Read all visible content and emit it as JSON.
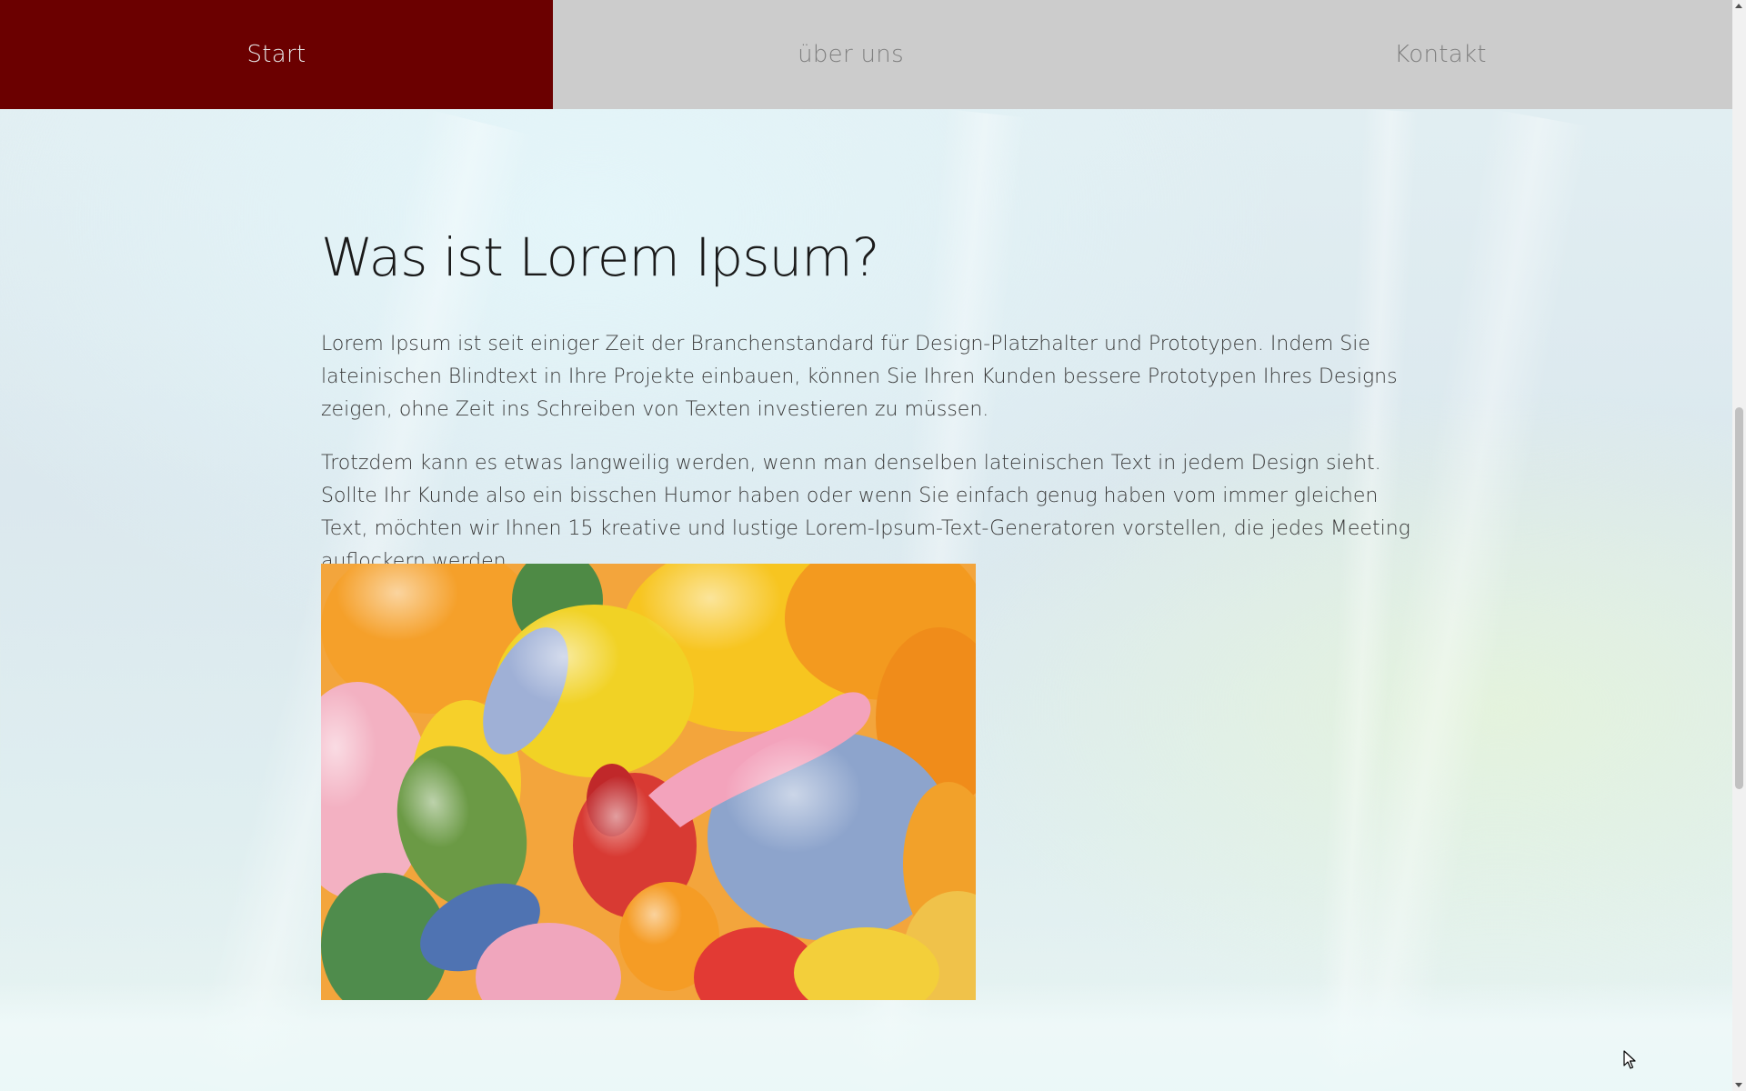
{
  "nav": {
    "items": [
      {
        "label": "Start",
        "active": true
      },
      {
        "label": "über uns",
        "active": false
      },
      {
        "label": "Kontakt",
        "active": false
      }
    ],
    "active_color": "#6b0000",
    "bar_color": "#cccccc"
  },
  "main": {
    "title": "Was ist Lorem Ipsum?",
    "paragraphs": [
      "Lorem Ipsum ist seit einiger Zeit der Branchenstandard für Design-Platzhalter und Prototypen. Indem Sie lateinischen Blindtext in Ihre Projekte einbauen, können Sie Ihren Kunden bessere Prototypen Ihres Designs zeigen, ohne Zeit ins Schreiben von Texten investieren zu müssen.",
      "Trotzdem kann es etwas langweilig werden, wenn man denselben lateinischen Text in jedem Design sieht. Sollte Ihr Kunde also ein bisschen Humor haben oder wenn Sie einfach genug haben vom immer gleichen Text, möchten wir Ihnen 15 kreative und lustige Lorem-Ipsum-Text-Generatoren vorstellen, die jedes Meeting auflockern werden."
    ],
    "image": {
      "subject": "colorful balloons"
    }
  },
  "icons": {
    "scroll_up": "scroll-up-arrow-icon",
    "scroll_down": "scroll-down-arrow-icon",
    "cursor": "mouse-pointer-icon"
  }
}
